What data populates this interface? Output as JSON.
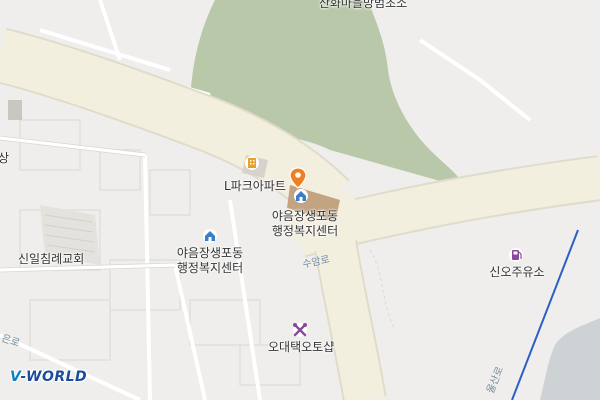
{
  "map": {
    "provider_logo": {
      "prefix": "V",
      "rest": "-WORLD"
    },
    "labels": {
      "top_label": "산화마을방범초소",
      "apartment": "L파크아파트",
      "welfare_center_main": [
        "야음장생포동",
        "행정복지센터"
      ],
      "welfare_center_other": [
        "야음장생포동",
        "행정복지센터"
      ],
      "church": "신일침례교회",
      "gas_station": "신오주유소",
      "auto_shop": "오대택오토샵",
      "edge_left": "상"
    },
    "road_labels": {
      "main_road": "수암로",
      "left_road": "은로",
      "right_road": "울산로"
    },
    "colors": {
      "background": "#efeeec",
      "road": "#f3efdf",
      "park": "#b8c8a8",
      "building_selected": "#c2a382",
      "marker": "#f07f22",
      "rail": "#2c5fc4",
      "water": "#cdd3d4",
      "poi_blue": "#3a7ec9",
      "poi_purple": "#8a4a9a",
      "poi_orange": "#e8a12d"
    },
    "icons": [
      "location-marker-icon",
      "apartment-icon",
      "public-office-icon",
      "gas-station-icon",
      "auto-repair-icon"
    ]
  }
}
